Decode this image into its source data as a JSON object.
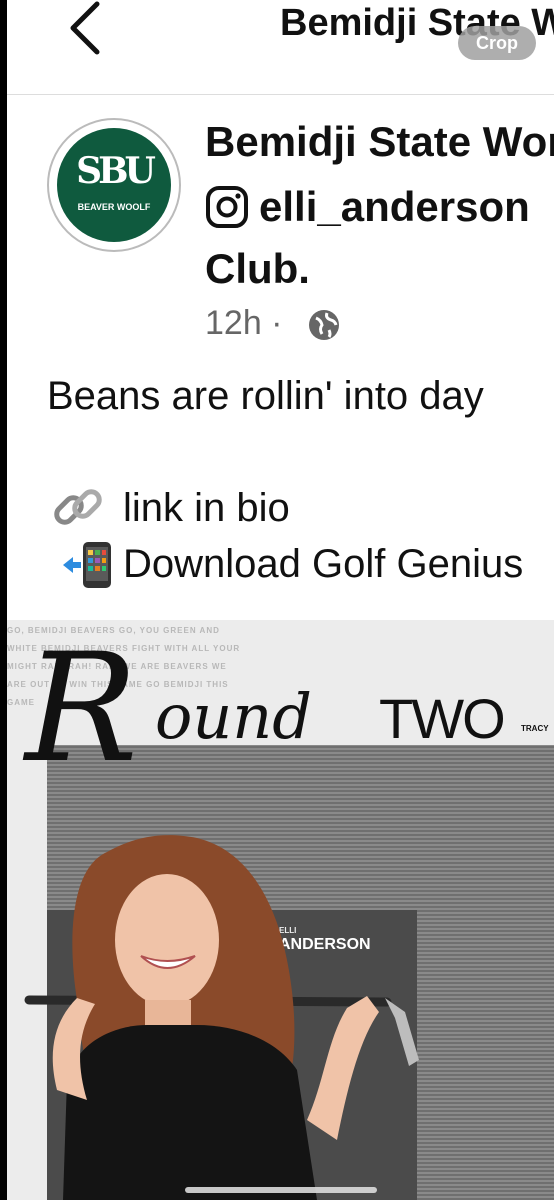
{
  "nav": {
    "title": "Bemidji State Women's Golf",
    "crop_label": "Crop"
  },
  "post": {
    "avatar_text": "SBU",
    "avatar_subtext": "BEAVER WOOLF",
    "author": "Bemidji State Women's Golf",
    "handle": "elli_anderson",
    "line3": "Club.",
    "time": "12h ·",
    "body_line1": "Beans are rollin' into day",
    "link_text": "link in bio",
    "download_text": "Download Golf Genius"
  },
  "graphic": {
    "chant": "GO, BEMIDJI BEAVERS GO, YOU GREEN AND WHITE BEMIDJI BEAVERS FIGHT WITH ALL YOUR MIGHT RAH! RAH! RAH! WE ARE BEAVERS WE ARE OUT TO WIN THIS FAME GO BEMIDJI THIS GAME",
    "title_r": "R",
    "title_ound": "ound",
    "title_two": "TWO",
    "side_name": "TRACY",
    "player_first": "ELLI",
    "player_last": "ANDERSON"
  },
  "icons": {
    "back": "chevron-left-icon",
    "instagram": "instagram-icon",
    "globe": "globe-icon",
    "link": "link-emoji",
    "phone": "mobile-phone-arrow-emoji"
  },
  "colors": {
    "brand_green": "#0f5a3e",
    "text": "#111111",
    "meta": "#666666"
  }
}
